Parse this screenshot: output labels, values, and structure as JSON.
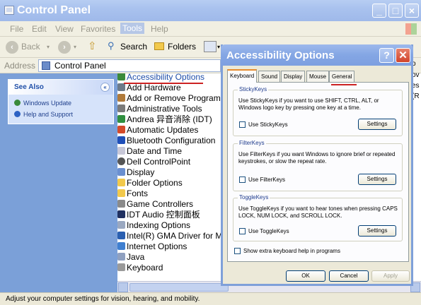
{
  "window": {
    "title": "Control Panel"
  },
  "menu": [
    "File",
    "Edit",
    "View",
    "Favorites",
    "Tools",
    "Help"
  ],
  "toolbar": {
    "back": "Back",
    "search": "Search",
    "folders": "Folders"
  },
  "address": {
    "label": "Address",
    "value": "Control Panel"
  },
  "left_pane": {
    "see_also_title": "See Also",
    "links": [
      "Windows Update",
      "Help and Support"
    ]
  },
  "items": [
    "Accessibility Options",
    "Add Hardware",
    "Add or Remove Programs",
    "Administrative Tools",
    "Andrea 异音消除 (IDT)",
    "Automatic Updates",
    "Bluetooth Configuration",
    "Date and Time",
    "Dell ControlPoint",
    "Display",
    "Folder Options",
    "Fonts",
    "Game Controllers",
    "IDT Audio 控制面板",
    "Indexing Options",
    "Intel(R) GMA Driver for M",
    "Internet Options",
    "Java",
    "Keyboard"
  ],
  "right_fragments": [
    "o",
    "ov",
    "es",
    "(R"
  ],
  "status": "Adjust your computer settings for vision, hearing, and mobility.",
  "dialog": {
    "title": "Accessibility Options",
    "tabs": [
      "Keyboard",
      "Sound",
      "Display",
      "Mouse",
      "General"
    ],
    "sticky": {
      "title": "StickyKeys",
      "desc": "Use StickyKeys if you want to use SHIFT, CTRL, ALT, or Windows logo key by pressing one key at a time.",
      "check": "Use StickyKeys",
      "settings": "Settings"
    },
    "filter": {
      "title": "FilterKeys",
      "desc": "Use FilterKeys if you want Windows to ignore brief or repeated keystrokes, or slow the repeat rate.",
      "check": "Use FilterKeys",
      "settings": "Settings"
    },
    "toggle": {
      "title": "ToggleKeys",
      "desc": "Use ToggleKeys if you want to hear tones when pressing CAPS LOCK, NUM LOCK, and SCROLL LOCK.",
      "check": "Use ToggleKeys",
      "settings": "Settings"
    },
    "extra_help": "Show extra keyboard help in programs",
    "ok": "OK",
    "cancel": "Cancel",
    "apply": "Apply"
  }
}
